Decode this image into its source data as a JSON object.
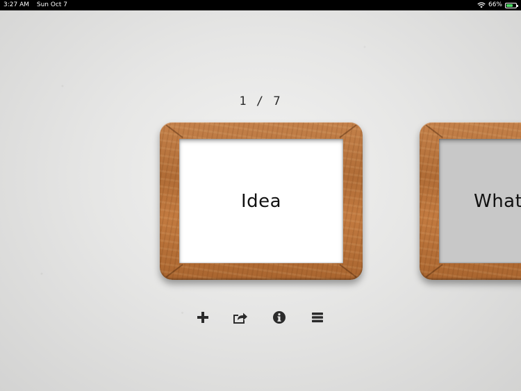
{
  "status_bar": {
    "time": "3:27 AM",
    "date": "Sun Oct 7",
    "battery_percent": "66%",
    "battery_level": 0.66,
    "icons": [
      "wifi-icon",
      "battery-icon"
    ]
  },
  "counter": {
    "text": "1 / 7"
  },
  "boards": [
    {
      "label": "Idea",
      "background": "#ffffff"
    },
    {
      "label": "What's",
      "background": "#c8c8c8"
    }
  ],
  "toolbar": {
    "icons": [
      "plus-icon",
      "share-icon",
      "info-icon",
      "menu-icon"
    ],
    "icon_color": "#2b2b2b"
  },
  "colors": {
    "wall": "#e6e6e5",
    "wood": "#b06c36",
    "battery_fill": "#4cd964"
  }
}
